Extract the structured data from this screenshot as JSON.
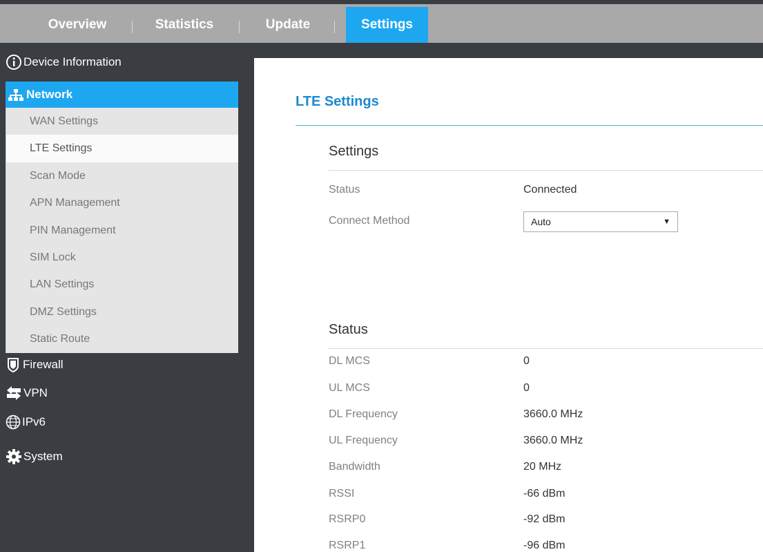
{
  "topnav": {
    "tabs": [
      "Overview",
      "Statistics",
      "Update",
      "Settings"
    ],
    "active": "Settings"
  },
  "sidebar": {
    "device_info": "Device Information",
    "network": "Network",
    "network_items": [
      "WAN Settings",
      "LTE Settings",
      "Scan Mode",
      "APN Management",
      "PIN Management",
      "SIM Lock",
      "LAN Settings",
      "DMZ Settings",
      "Static Route"
    ],
    "selected_item": "LTE Settings",
    "firewall": "Firewall",
    "vpn": "VPN",
    "ipv6": "IPv6",
    "system": "System"
  },
  "page": {
    "title": "LTE Settings",
    "settings_section": {
      "heading": "Settings",
      "status_label": "Status",
      "status_value": "Connected",
      "connect_method_label": "Connect Method",
      "connect_method_value": "Auto"
    },
    "status_section": {
      "heading": "Status",
      "rows": [
        {
          "label": "DL MCS",
          "value": "0"
        },
        {
          "label": "UL MCS",
          "value": "0"
        },
        {
          "label": "DL Frequency",
          "value": "3660.0 MHz"
        },
        {
          "label": "UL Frequency",
          "value": "3660.0 MHz"
        },
        {
          "label": "Bandwidth",
          "value": "20 MHz"
        },
        {
          "label": "RSSI",
          "value": "-66 dBm"
        },
        {
          "label": "RSRP0",
          "value": "-92 dBm"
        },
        {
          "label": "RSRP1",
          "value": "-96 dBm"
        }
      ]
    }
  },
  "colors": {
    "accent": "#1ea7f1",
    "title": "#1b8ad0",
    "sidebar_bg": "#3a3d42",
    "topbar_bg": "#a9a9a9"
  }
}
